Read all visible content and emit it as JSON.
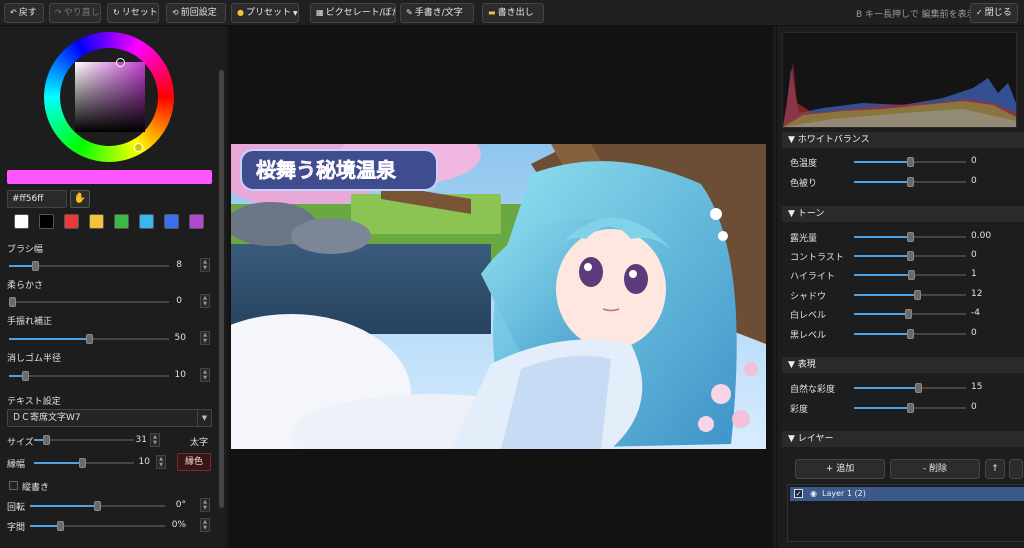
{
  "toolbar": {
    "undo": "戻す",
    "redo": "やり直し",
    "reset": "リセット",
    "prev_settings": "前回設定",
    "preset": "プリセット",
    "pixelate": "ピクセレート/ぼかし",
    "handwriting": "手書き/文字",
    "export": "書き出し",
    "hint": "B キー長押しで 編集前を表示",
    "close": "閉じる"
  },
  "color": {
    "hex": "#ff56ff",
    "current": "#ff56ff",
    "swatches": [
      "#ffffff",
      "#000000",
      "#e83a3a",
      "#f5c33b",
      "#3cb84a",
      "#3ab7f0",
      "#3a6ff0",
      "#b04ad0"
    ]
  },
  "brush": {
    "size_label": "ブラシ幅",
    "size_value": "8",
    "softness_label": "柔らかさ",
    "softness_value": "0",
    "stabilizer_label": "手振れ補正",
    "stabilizer_value": "50",
    "eraser_label": "消しゴム半径",
    "eraser_value": "10"
  },
  "text": {
    "section_label": "テキスト設定",
    "font": "ＤＣ寄席文字W7",
    "size_label": "サイズ",
    "size_value": "31",
    "bold_label": "太字",
    "stroke_label": "縁幅",
    "stroke_value": "10",
    "stroke_color_label": "縁色",
    "vertical_label": "縦書き",
    "rotate_label": "回転",
    "rotate_value": "0°",
    "spacing_label": "字間",
    "spacing_value": "0%"
  },
  "canvas": {
    "banner_text": "桜舞う秘境温泉"
  },
  "white_balance": {
    "title": "▼ ホワイトバランス",
    "temp_label": "色温度",
    "temp_value": "0",
    "tint_label": "色被り",
    "tint_value": "0"
  },
  "tone": {
    "title": "▼ トーン",
    "exposure_label": "露光量",
    "exposure_value": "0.00",
    "contrast_label": "コントラスト",
    "contrast_value": "0",
    "highlight_label": "ハイライト",
    "highlight_value": "1",
    "shadow_label": "シャドウ",
    "shadow_value": "12",
    "white_label": "白レベル",
    "white_value": "-4",
    "black_label": "黒レベル",
    "black_value": "0"
  },
  "presence": {
    "title": "▼ 表現",
    "vibrance_label": "自然な彩度",
    "vibrance_value": "15",
    "saturation_label": "彩度",
    "saturation_value": "0"
  },
  "layers": {
    "title": "▼ レイヤー",
    "add": "+ 追加",
    "delete": "- 削除",
    "up": "↑",
    "items": [
      {
        "name": "Layer 1 (2)",
        "checked": "✓"
      }
    ]
  }
}
